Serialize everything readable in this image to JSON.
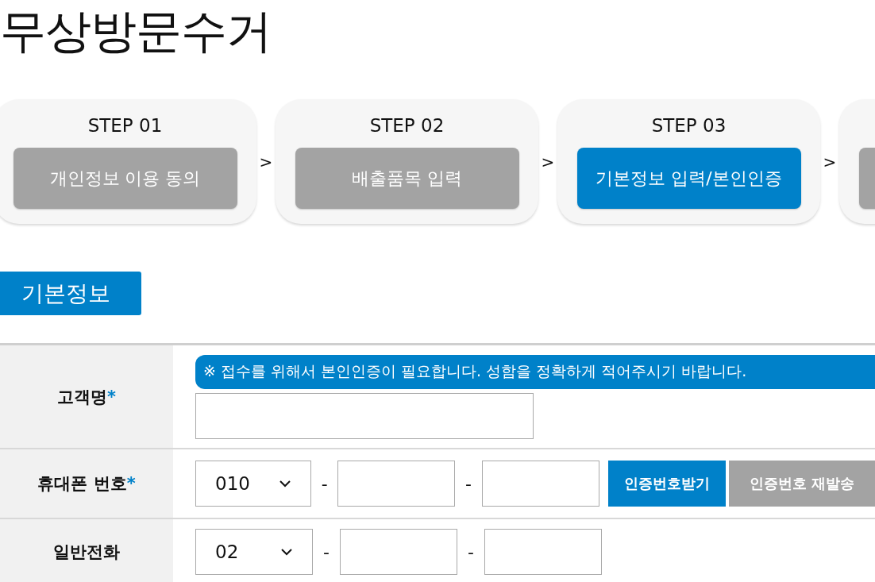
{
  "title": "무상방문수거",
  "steps": [
    {
      "label": "STEP 01",
      "button": "개인정보 이용 동의",
      "selected": false,
      "arrow": ">"
    },
    {
      "label": "STEP 02",
      "button": "배출품목 입력",
      "selected": false,
      "arrow": ">"
    },
    {
      "label": "STEP 03",
      "button": "기본정보 입력/본인인증",
      "selected": true,
      "arrow": ">"
    },
    {
      "selected": false
    }
  ],
  "section_title": "기본정보",
  "form": {
    "rows": [
      {
        "kind": "name",
        "label": "고객명",
        "required": "*",
        "notice": "※ 접수를 위해서 본인인증이 필요합니다. 성함을 정확하게 적어주시기 바랍니다."
      },
      {
        "kind": "phone",
        "label": "휴대폰 번호",
        "required": "*",
        "prefix": "010",
        "dash": "-",
        "buttons": [
          {
            "label": "인증번호받기",
            "primary": true
          },
          {
            "label": "인증번호 재발송",
            "primary": false
          }
        ]
      },
      {
        "kind": "phone",
        "label": "일반전화",
        "prefix": "02",
        "dash": "-"
      }
    ]
  }
}
